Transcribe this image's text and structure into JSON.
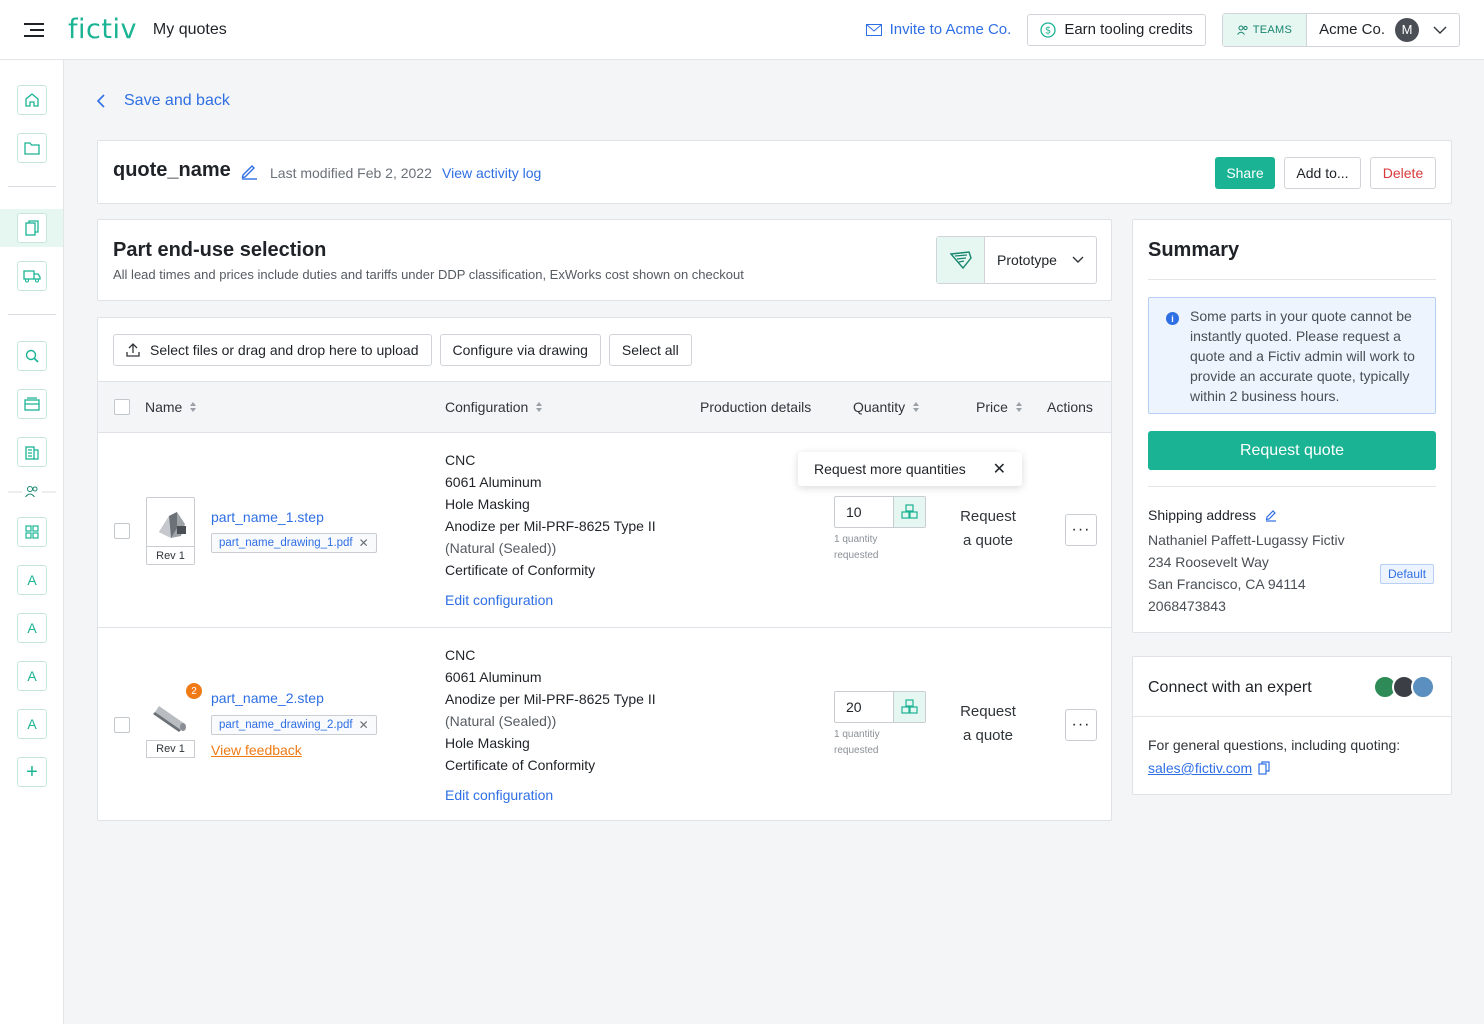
{
  "app": {
    "logo": "fictiv",
    "page_name": "My quotes",
    "invite_label": "Invite to Acme Co.",
    "earn_label": "Earn tooling credits",
    "teams_label": "TEAMS",
    "org_name": "Acme Co.",
    "avatar_initial": "M"
  },
  "sidebar": {
    "items": [
      {
        "name": "home-icon",
        "glyph": ""
      },
      {
        "name": "folder-icon",
        "glyph": ""
      },
      {
        "name": "quotes-icon",
        "glyph": ""
      },
      {
        "name": "truck-icon",
        "glyph": ""
      },
      {
        "name": "search-icon",
        "glyph": ""
      },
      {
        "name": "inbox-icon",
        "glyph": ""
      },
      {
        "name": "building-icon",
        "glyph": ""
      },
      {
        "name": "grid-icon",
        "glyph": ""
      },
      {
        "name": "account-a-1",
        "glyph": "A"
      },
      {
        "name": "account-a-2",
        "glyph": "A"
      },
      {
        "name": "account-a-3",
        "glyph": "A"
      },
      {
        "name": "account-a-4",
        "glyph": "A"
      },
      {
        "name": "plus-icon",
        "glyph": "+"
      }
    ]
  },
  "back_label": "Save and back",
  "quote": {
    "name": "quote_name",
    "modified": "Last modified Feb 2, 2022",
    "activity_link": "View activity log",
    "share": "Share",
    "add_to": "Add to...",
    "delete": "Delete"
  },
  "end_use": {
    "title": "Part end-use selection",
    "subtitle": "All lead times and prices include duties and tariffs under DDP classification, ExWorks cost shown on checkout",
    "selected": "Prototype"
  },
  "toolbar": {
    "upload": "Select files or drag and drop here to upload",
    "configure": "Configure via drawing",
    "select_all": "Select all"
  },
  "table": {
    "headers": {
      "name": "Name",
      "configuration": "Configuration",
      "production": "Production details",
      "quantity": "Quantity",
      "price": "Price",
      "actions": "Actions"
    },
    "rows": [
      {
        "rev": "Rev 1",
        "file": "part_name_1.step",
        "drawing": "part_name_drawing_1.pdf",
        "config": [
          "CNC",
          "6061 Aluminum",
          "Hole Masking",
          "Anodize per Mil-PRF-8625 Type II",
          "(Natural (Sealed))",
          "Certificate of Conformity"
        ],
        "edit": "Edit configuration",
        "qty": "10",
        "qty_note_1": "1 quantity",
        "qty_note_2": "requested",
        "price_1": "Request",
        "price_2": "a quote"
      },
      {
        "rev": "Rev 1",
        "badge": "2",
        "file": "part_name_2.step",
        "drawing": "part_name_drawing_2.pdf",
        "feedback": "View feedback",
        "config": [
          "CNC",
          "6061 Aluminum",
          "Anodize per Mil-PRF-8625 Type II",
          "(Natural (Sealed))",
          "Hole Masking",
          "Certificate of Conformity"
        ],
        "edit": "Edit configuration",
        "qty": "20",
        "qty_note_1": "1 quantitiy",
        "qty_note_2": "requested",
        "price_1": "Request",
        "price_2": "a quote"
      }
    ],
    "tooltip": "Request more quantities"
  },
  "summary": {
    "title": "Summary",
    "info": "Some parts in your quote cannot be instantly quoted. Please request a quote and a Fictiv admin will work to provide an accurate quote, typically within 2 business hours.",
    "request_btn": "Request quote",
    "ship_label": "Shipping address",
    "address": [
      "Nathaniel Paffett-Lugassy Fictiv",
      "234 Roosevelt Way",
      "San Francisco, CA 94114",
      "2068473843"
    ],
    "default_tag": "Default"
  },
  "expert": {
    "title": "Connect with an expert",
    "text": "For general questions, including quoting:",
    "email": "sales@fictiv.com"
  },
  "colors": {
    "brand": "#1ab394",
    "link": "#2f6fe4",
    "danger": "#d83a3a",
    "warning": "#f07b16"
  }
}
